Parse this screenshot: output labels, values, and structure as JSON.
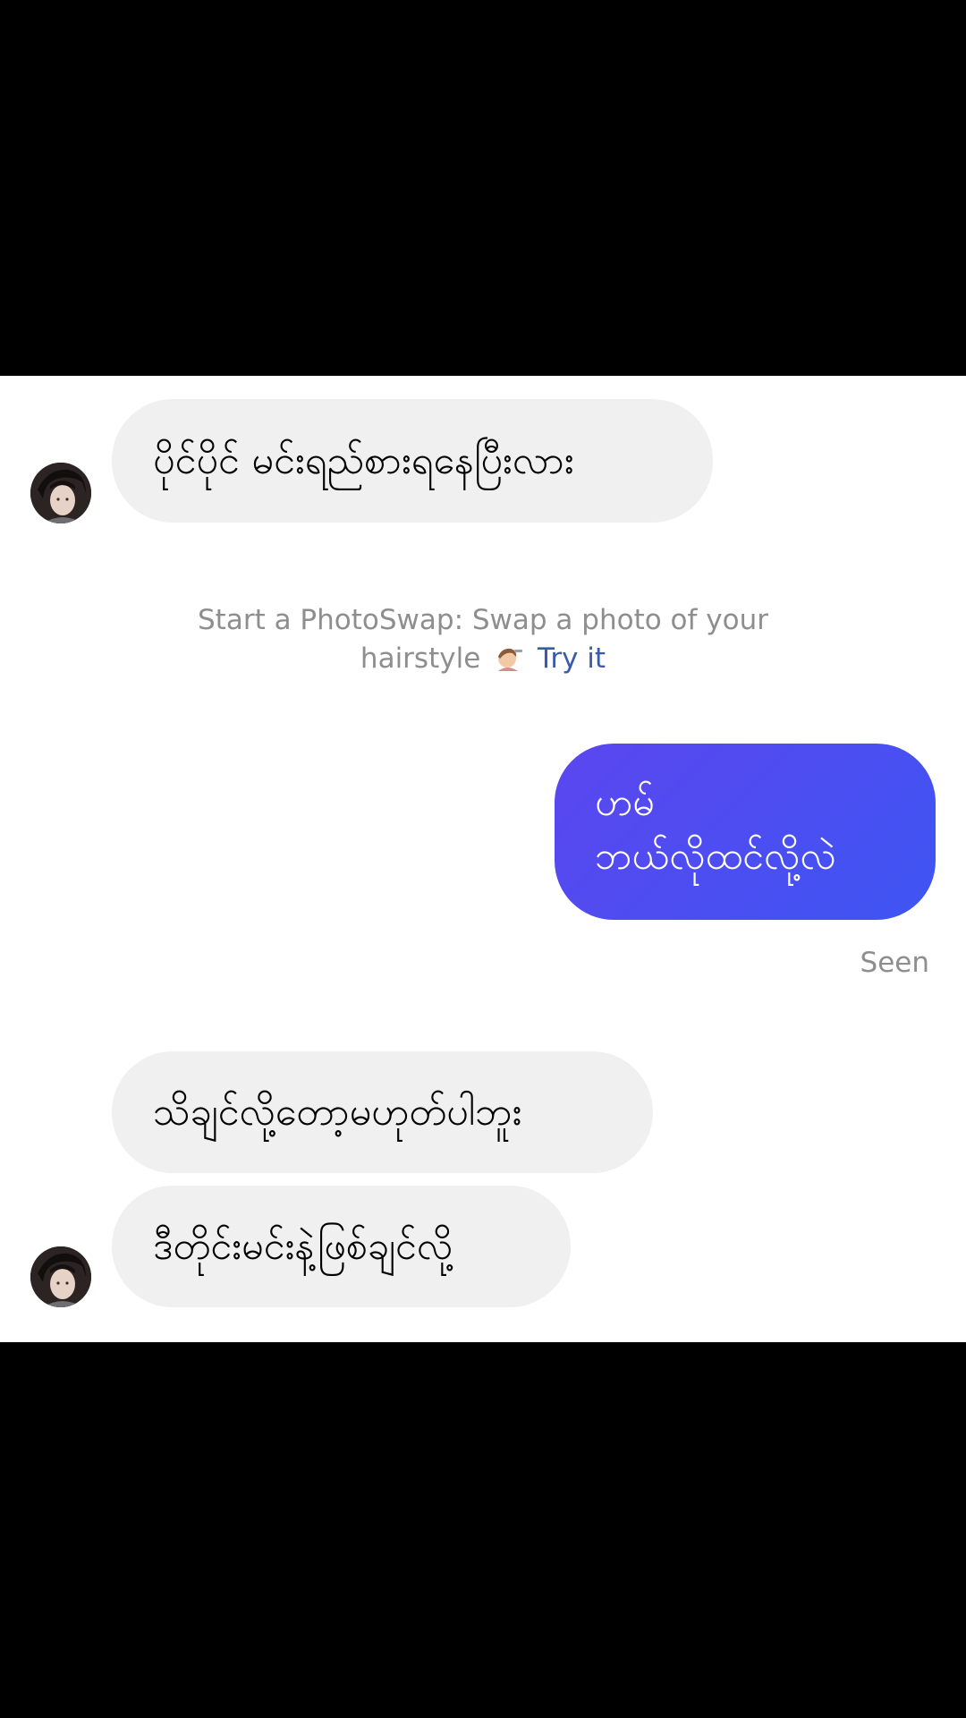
{
  "messages": {
    "m1": {
      "text": "ပိုင်ပိုင် မင်းရည်စားရနေပြီးလား"
    },
    "m2": {
      "line1": "ဟမ်",
      "line2": "ဘယ်လိုထင်လို့လဲ"
    },
    "m3": {
      "text": "သိချင်လို့တော့မဟုတ်ပါဘူး"
    },
    "m4": {
      "text": "ဒီတိုင်းမင်းနဲ့ဖြစ်ချင်လို့"
    }
  },
  "system_prompt": {
    "line1": "Start a PhotoSwap: Swap a photo of your",
    "line2_prefix": "hairstyle",
    "emoji_icon": "haircut-person-icon",
    "link_label": "Try it"
  },
  "status": {
    "seen_label": "Seen"
  },
  "colors": {
    "outgoing_bubble_start": "#5b46ef",
    "outgoing_bubble_end": "#3e55f3",
    "incoming_bubble": "#f0f0f0",
    "link": "#3a5ba9",
    "muted_text": "#8e8e8e"
  }
}
